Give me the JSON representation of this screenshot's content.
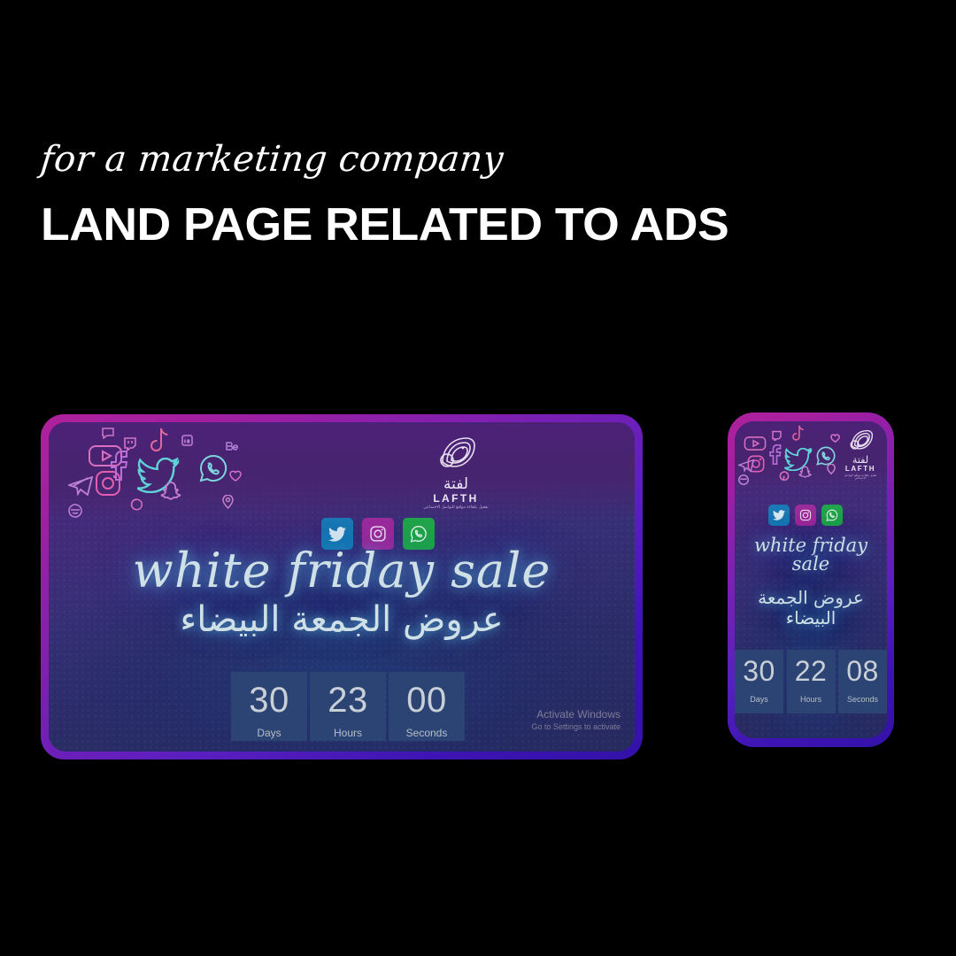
{
  "poster": {
    "script_line": "for a marketing company",
    "title_line": "LAND PAGE RELATED TO ADS",
    "background_color": "#000000",
    "text_color": "#ffffff"
  },
  "brand": {
    "arabic_name": "لفتة",
    "latin_name": "LAFTH",
    "tagline_arabic": "تفعيل بكفاءة مواقع التواصل الاجتماعي",
    "logo_icon": "swirl-wave-logo-icon"
  },
  "social_buttons": [
    {
      "name": "twitter",
      "label": "Twitter",
      "icon": "twitter-bird-icon",
      "color": "#1b79b5"
    },
    {
      "name": "instagram",
      "label": "Instagram",
      "icon": "instagram-camera-icon",
      "color": "#9c2b9c"
    },
    {
      "name": "whatsapp",
      "label": "WhatsApp",
      "icon": "whatsapp-phone-icon",
      "color": "#21a44b"
    }
  ],
  "doodle_icons": [
    "youtube-icon",
    "instagram-icon",
    "facebook-icon",
    "twitter-icon",
    "telegram-icon",
    "tiktok-icon",
    "snapchat-icon",
    "pinterest-icon",
    "whatsapp-icon",
    "twitch-icon",
    "reddit-icon",
    "linkedin-icon",
    "behance-icon",
    "location-pin-icon",
    "heart-icon",
    "chat-bubble-icon"
  ],
  "hero": {
    "headline_en": "white friday  sale",
    "headline_en_mobile": "white friday sale",
    "headline_ar": "عروض الجمعة البيضاء",
    "glow_color": "#5abee6",
    "text_color": "#cfe0e6"
  },
  "desktop_mockup": {
    "device": "desktop-browser-frame",
    "countdown": [
      {
        "value": "30",
        "label": "Days"
      },
      {
        "value": "23",
        "label": "Hours"
      },
      {
        "value": "00",
        "label": "Seconds"
      }
    ],
    "countdown_box_color": "#2c4473",
    "frame_gradient_start": "#b0219c",
    "frame_gradient_end": "#3311a8"
  },
  "mobile_mockup": {
    "device": "mobile-phone-frame",
    "countdown": [
      {
        "value": "30",
        "label": "Days"
      },
      {
        "value": "22",
        "label": "Hours"
      },
      {
        "value": "08",
        "label": "Seconds"
      }
    ],
    "countdown_box_color": "#2c4473"
  },
  "windows_watermark": {
    "line1": "Activate Windows",
    "line2": "Go to Settings to activate"
  }
}
